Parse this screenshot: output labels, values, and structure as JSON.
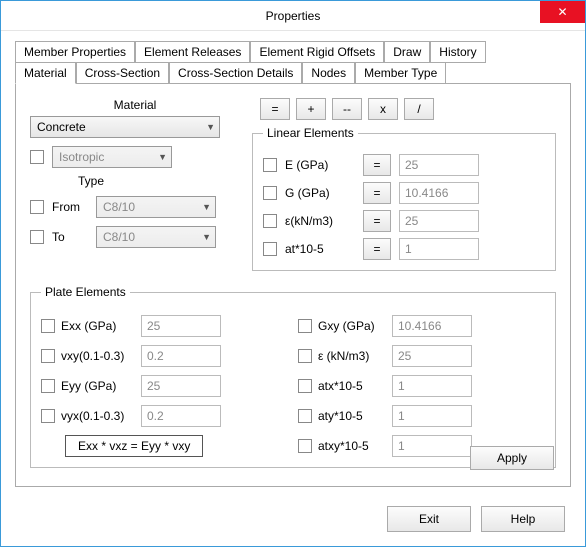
{
  "window": {
    "title": "Properties"
  },
  "tabs_row1": {
    "member_props": "Member Properties",
    "element_releases": "Element Releases",
    "element_rigid_offsets": "Element Rigid Offsets",
    "draw": "Draw",
    "history": "History"
  },
  "tabs_row2": {
    "material": "Material",
    "cross_section": "Cross-Section",
    "cross_section_details": "Cross-Section Details",
    "nodes": "Nodes",
    "member_type": "Member Type"
  },
  "material": {
    "heading": "Material",
    "selected": "Concrete",
    "isotropic": "Isotropic",
    "type_label": "Type",
    "from_label": "From",
    "from_value": "C8/10",
    "to_label": "To",
    "to_value": "C8/10"
  },
  "ops": {
    "eq": "=",
    "plus": "+",
    "minus": "--",
    "times": "x",
    "div": "/"
  },
  "linear": {
    "legend": "Linear Elements",
    "e_label": "E (GPa)",
    "e_val": "25",
    "g_label": "G (GPa)",
    "g_val": "10.4166",
    "eps_label": "ε(kN/m3)",
    "eps_val": "25",
    "at_label": "at*10-5",
    "at_val": "1",
    "eq": "="
  },
  "plate": {
    "legend": "Plate Elements",
    "exx_label": "Exx (GPa)",
    "exx_val": "25",
    "vxy_label": "vxy(0.1-0.3)",
    "vxy_val": "0.2",
    "eyy_label": "Eyy (GPa)",
    "eyy_val": "25",
    "vyx_label": "vyx(0.1-0.3)",
    "vyx_val": "0.2",
    "gxy_label": "Gxy (GPa)",
    "gxy_val": "10.4166",
    "eps_label": "ε (kN/m3)",
    "eps_val": "25",
    "atx_label": "atx*10-5",
    "atx_val": "1",
    "aty_label": "aty*10-5",
    "aty_val": "1",
    "atxy_label": "atxy*10-5",
    "atxy_val": "1",
    "formula": "Exx * vxz = Eyy * vxy"
  },
  "buttons": {
    "apply": "Apply",
    "exit": "Exit",
    "help": "Help"
  }
}
